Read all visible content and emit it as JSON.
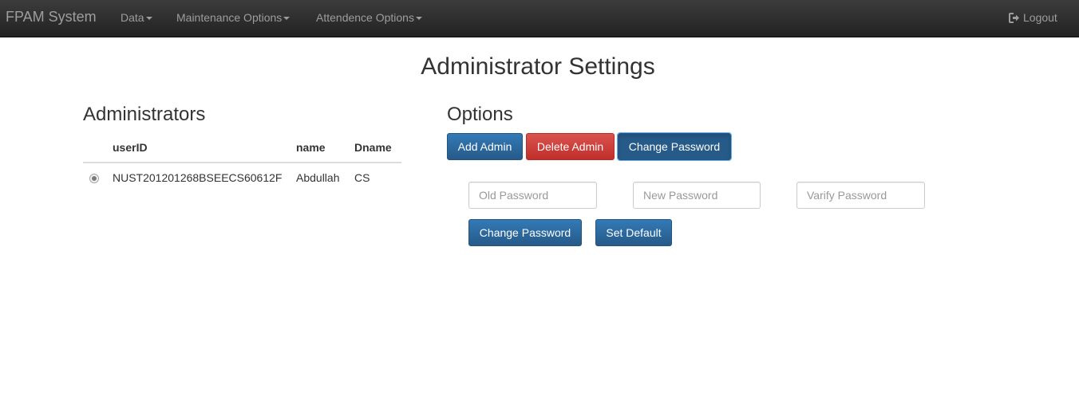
{
  "navbar": {
    "brand": "FPAM System",
    "menus": [
      {
        "label": "Data"
      },
      {
        "label": "Maintenance Options"
      },
      {
        "label": "Attendence Options"
      }
    ],
    "logout": "Logout"
  },
  "page": {
    "title": "Administrator Settings"
  },
  "administrators": {
    "heading": "Administrators",
    "columns": [
      "userID",
      "name",
      "Dname"
    ],
    "rows": [
      {
        "selected": true,
        "userID": "NUST201201268BSEECS60612F",
        "name": "Abdullah",
        "Dname": "CS"
      }
    ]
  },
  "options": {
    "heading": "Options",
    "buttons": {
      "add_admin": "Add Admin",
      "delete_admin": "Delete Admin",
      "change_password": "Change Password"
    },
    "password_form": {
      "old_placeholder": "Old Password",
      "new_placeholder": "New Password",
      "verify_placeholder": "Varify Password",
      "submit_label": "Change Password",
      "default_label": "Set Default"
    }
  },
  "colors": {
    "navbar_bg": "#222222",
    "primary": "#337ab7",
    "danger": "#d9534f"
  }
}
